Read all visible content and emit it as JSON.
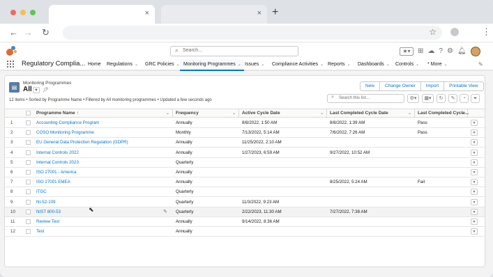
{
  "browser": {
    "traffic_colors": [
      "#ed6a5e",
      "#f5bf4f",
      "#61c554"
    ],
    "tab_close_symbol": "×",
    "new_tab_symbol": "+"
  },
  "header": {
    "search_placeholder": "Search...",
    "icons": [
      "favorites-icon",
      "add-icon",
      "trailhead-icon",
      "help-icon",
      "settings-icon",
      "notification-bell-icon",
      "user-avatar"
    ]
  },
  "nav": {
    "app_name": "Regulatory Complia...",
    "items": [
      {
        "label": "Home",
        "has_menu": false
      },
      {
        "label": "Regulations",
        "has_menu": true
      },
      {
        "label": "GRC Policies",
        "has_menu": true
      },
      {
        "label": "Monitoring Programmes",
        "has_menu": true,
        "active": true
      },
      {
        "label": "Issues",
        "has_menu": true
      },
      {
        "label": "Compliance Activities",
        "has_menu": true
      },
      {
        "label": "Reports",
        "has_menu": true
      },
      {
        "label": "Dashboards",
        "has_menu": true
      },
      {
        "label": "Controls",
        "has_menu": true
      },
      {
        "label": "* More",
        "has_menu": true
      }
    ],
    "accent": "#0176d3"
  },
  "list_view": {
    "object_name": "Monitoring Programmes",
    "view_name": "All",
    "buttons": [
      "New",
      "Change Owner",
      "Import",
      "Printable View"
    ],
    "status": "12 items • Sorted by Programme Name • Filtered by All monitoring programmes • Updated a few seconds ago",
    "search_placeholder": "Search this list...",
    "columns": [
      "Programme Name",
      "Frequency",
      "Active Cycle Date",
      "Last Completed Cycle Date",
      "Last Completed Cycle..."
    ],
    "sort_indicator": "↑",
    "rows": [
      {
        "n": "1",
        "name": "Accounting Compliance Program",
        "freq": "Annually",
        "active": "8/8/2022, 1:50 AM",
        "last": "8/8/2022, 1:39 AM",
        "result": "Pass"
      },
      {
        "n": "2",
        "name": "COSO Monitoring Programme",
        "freq": "Monthly",
        "active": "7/13/2022, 5:14 AM",
        "last": "7/6/2022, 7:26 AM",
        "result": "Pass"
      },
      {
        "n": "3",
        "name": "EU General Data Protection Regulation (GDPR)",
        "freq": "Annually",
        "active": "11/25/2022, 2:10 AM",
        "last": "",
        "result": ""
      },
      {
        "n": "4",
        "name": "Internal Controls 2022",
        "freq": "Annually",
        "active": "1/27/2023, 6:59 AM",
        "last": "9/27/2022, 10:52 AM",
        "result": ""
      },
      {
        "n": "5",
        "name": "Internal Controls 2023",
        "freq": "Quarterly",
        "active": "",
        "last": "",
        "result": ""
      },
      {
        "n": "6",
        "name": "ISO 27001 - America",
        "freq": "Annually",
        "active": "",
        "last": "",
        "result": ""
      },
      {
        "n": "7",
        "name": "ISO 27001 EMEA",
        "freq": "Annually",
        "active": "",
        "last": "8/25/2022, 5:24 AM",
        "result": "Fail"
      },
      {
        "n": "8",
        "name": "ITGC",
        "freq": "Quarterly",
        "active": "",
        "last": "",
        "result": ""
      },
      {
        "n": "9",
        "name": "NI-52-109",
        "freq": "Quarterly",
        "active": "11/3/2022, 9:23 AM",
        "last": "",
        "result": ""
      },
      {
        "n": "10",
        "name": "NIST 800-53",
        "freq": "Quarterly",
        "active": "2/22/2023, 11:30 AM",
        "last": "7/27/2022, 7:38 AM",
        "result": ""
      },
      {
        "n": "11",
        "name": "Review Test",
        "freq": "Annually",
        "active": "9/14/2022, 8:36 AM",
        "last": "",
        "result": ""
      },
      {
        "n": "12",
        "name": "Test",
        "freq": "Annually",
        "active": "",
        "last": "",
        "result": ""
      }
    ],
    "hover_row": 10
  }
}
